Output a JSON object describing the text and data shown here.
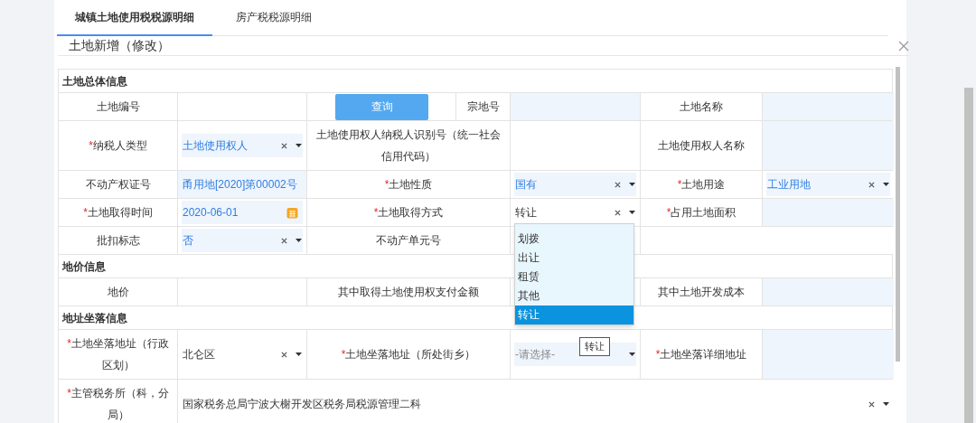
{
  "tabs": [
    {
      "label": "城镇土地使用税税源明细",
      "selected": true
    },
    {
      "label": "房产税税源明细",
      "selected": false
    }
  ],
  "dialog": {
    "title": "土地新增（修改）"
  },
  "sections": [
    {
      "title": "土地总体信息",
      "rows": [
        [
          {
            "kind": "label",
            "text": "土地编号"
          },
          {
            "kind": "input",
            "shaded": false
          },
          {
            "kind": "button",
            "label": "查询"
          },
          {
            "kind": "label",
            "text": "宗地号"
          },
          {
            "kind": "input",
            "shaded": true
          },
          {
            "kind": "label",
            "text": "土地名称"
          },
          {
            "kind": "input",
            "shaded": true
          }
        ],
        [
          {
            "kind": "label",
            "text": "纳税人类型",
            "required_mark": "*"
          },
          {
            "kind": "select",
            "value": "土地使用权人",
            "shaded": true
          },
          {
            "kind": "label",
            "text": "土地使用权人纳税人识别号（统一社会信用代码）",
            "colspan": 2
          },
          {
            "kind": "input",
            "shaded": false
          },
          {
            "kind": "label",
            "text": "土地使用权人名称"
          },
          {
            "kind": "input",
            "shaded": true
          }
        ],
        [
          {
            "kind": "label",
            "text": "不动产权证号"
          },
          {
            "kind": "input",
            "value": "甬用地[2020]第00002号",
            "shaded": true
          },
          {
            "kind": "label",
            "text": "土地性质",
            "required_mark": "*",
            "colspan": 2
          },
          {
            "kind": "select",
            "value": "国有",
            "shaded": true
          },
          {
            "kind": "label",
            "text": "土地用途",
            "required_mark": "*"
          },
          {
            "kind": "select",
            "value": "工业用地",
            "shaded": true
          }
        ],
        [
          {
            "kind": "label",
            "text": "土地取得时间",
            "required_mark": "*"
          },
          {
            "kind": "date",
            "value": "2020-06-01",
            "shaded": true
          },
          {
            "kind": "label",
            "text": "土地取得方式",
            "required_mark": "*",
            "colspan": 2
          },
          {
            "kind": "select",
            "value": "转让",
            "shaded": false,
            "options": [
              {
                "label": "划拨",
                "selected": false
              },
              {
                "label": "出让",
                "selected": false
              },
              {
                "label": "租赁",
                "selected": false
              },
              {
                "label": "其他",
                "selected": false
              },
              {
                "label": "转让",
                "selected": true
              }
            ]
          },
          {
            "kind": "label",
            "text": "占用土地面积",
            "required_mark": "*"
          },
          {
            "kind": "input",
            "shaded": true
          }
        ],
        [
          {
            "kind": "label",
            "text": "批扣标志"
          },
          {
            "kind": "select",
            "value": "否",
            "shaded": true
          },
          {
            "kind": "label",
            "text": "不动产单元号",
            "colspan": 2
          },
          {
            "kind": "input",
            "shaded": false
          },
          {
            "kind": "input",
            "shaded": false,
            "colspan": 2
          }
        ]
      ]
    },
    {
      "title": "地价信息",
      "rows": [
        [
          {
            "kind": "label",
            "text": "地价"
          },
          {
            "kind": "input",
            "shaded": false
          },
          {
            "kind": "label",
            "text": "其中取得土地使用权支付金额",
            "colspan": 2
          },
          {
            "kind": "input",
            "shaded": false
          },
          {
            "kind": "label",
            "text": "其中土地开发成本"
          },
          {
            "kind": "input",
            "shaded": true
          }
        ]
      ]
    },
    {
      "title": "地址坐落信息",
      "rows": [
        [
          {
            "kind": "label",
            "text": "土地坐落地址（行政区划）",
            "required_mark": "*"
          },
          {
            "kind": "select",
            "value": "北仑区",
            "shaded": false
          },
          {
            "kind": "label",
            "text": "土地坐落地址（所处街乡）",
            "required_mark": "*",
            "colspan": 2
          },
          {
            "kind": "select",
            "placeholder": "-请选择-",
            "shaded": true,
            "tooltip": "转让"
          },
          {
            "kind": "label",
            "text": "土地坐落详细地址",
            "required_mark": "*"
          },
          {
            "kind": "input",
            "shaded": true
          }
        ],
        [
          {
            "kind": "label",
            "text": "主管税务所（科，分局）",
            "required_mark": "*"
          },
          {
            "kind": "select",
            "value": "国家税务总局宁波大榭开发区税务局税源管理二科",
            "shaded": false,
            "colspan": 6
          }
        ]
      ]
    }
  ]
}
